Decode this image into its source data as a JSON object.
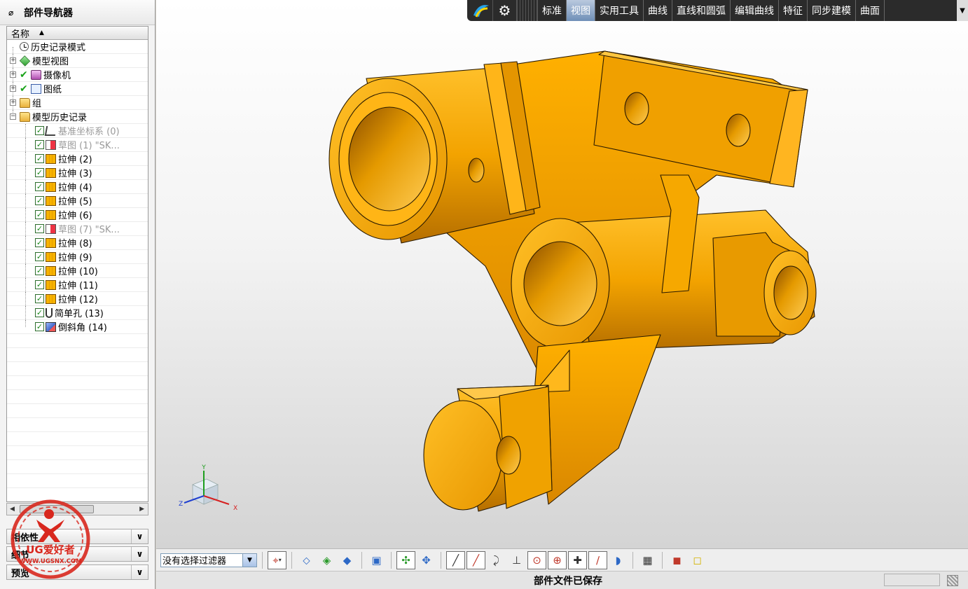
{
  "navigator": {
    "title": "部件导航器",
    "column_name": "名称",
    "nodes": [
      {
        "label": "历史记录模式",
        "icon": "history-clock-icon"
      },
      {
        "label": "模型视图",
        "icon": "model-view-icon"
      },
      {
        "label": "摄像机",
        "icon": "camera-icon"
      },
      {
        "label": "图纸",
        "icon": "drawing-sheet-icon"
      },
      {
        "label": "组",
        "icon": "folder-icon"
      },
      {
        "label": "模型历史记录",
        "icon": "folder-open-icon"
      }
    ],
    "features": [
      {
        "label": "基准坐标系 (0)",
        "icon": "datum-csys-icon",
        "greyed": true
      },
      {
        "label": "草图 (1) \"SK...",
        "icon": "sketch-icon",
        "greyed": true
      },
      {
        "label": "拉伸 (2)",
        "icon": "extrude-icon",
        "greyed": false
      },
      {
        "label": "拉伸 (3)",
        "icon": "extrude-icon",
        "greyed": false
      },
      {
        "label": "拉伸 (4)",
        "icon": "extrude-icon",
        "greyed": false
      },
      {
        "label": "拉伸 (5)",
        "icon": "extrude-icon",
        "greyed": false
      },
      {
        "label": "拉伸 (6)",
        "icon": "extrude-icon",
        "greyed": false
      },
      {
        "label": "草图 (7) \"SK...",
        "icon": "sketch-icon",
        "greyed": true
      },
      {
        "label": "拉伸 (8)",
        "icon": "extrude-icon",
        "greyed": false
      },
      {
        "label": "拉伸 (9)",
        "icon": "extrude-icon",
        "greyed": false
      },
      {
        "label": "拉伸 (10)",
        "icon": "extrude-icon",
        "greyed": false
      },
      {
        "label": "拉伸 (11)",
        "icon": "extrude-icon",
        "greyed": false
      },
      {
        "label": "拉伸 (12)",
        "icon": "extrude-icon",
        "greyed": false
      },
      {
        "label": "简单孔 (13)",
        "icon": "hole-icon",
        "greyed": false
      },
      {
        "label": "倒斜角 (14)",
        "icon": "chamfer-icon",
        "greyed": false
      }
    ],
    "panels": [
      "相依性",
      "细节",
      "预览"
    ],
    "panel_toggle_icon": "chevron-down-icon"
  },
  "logo": {
    "brand_text": "UG爱好者",
    "url_text": "WWW.UGSNX.COM"
  },
  "ribbon": {
    "tabs": [
      "标准",
      "视图",
      "实用工具",
      "曲线",
      "直线和圆弧",
      "编辑曲线",
      "特征",
      "同步建模",
      "曲面"
    ],
    "active_tab": "视图"
  },
  "triad": {
    "x": "X",
    "y": "Y",
    "z": "Z"
  },
  "toolbar": {
    "filter_value": "没有选择过滤器"
  },
  "status": {
    "message": "部件文件已保存"
  },
  "colors": {
    "part_orange": "#F5A300",
    "ribbon_bg": "#2B2B2B",
    "active_tab": "#8FA9CB"
  }
}
